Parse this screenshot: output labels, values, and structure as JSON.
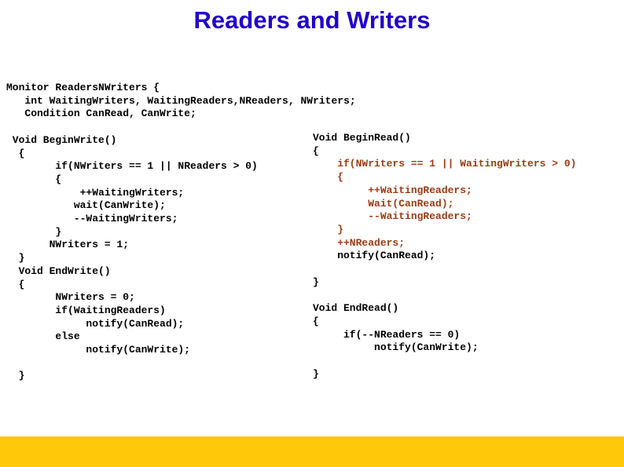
{
  "slide": {
    "title": "Readers and Writers",
    "title_color": "#2000CC",
    "background_color": "#ffffff",
    "bottom_bar_color": "#FFC808"
  },
  "code_left": {
    "name": "writer-monitor-code",
    "color_default": "#000000",
    "lines": [
      "Monitor ReadersNWriters {",
      "   int WaitingWriters, WaitingReaders,NReaders, NWriters;",
      "   Condition CanRead, CanWrite;",
      "",
      " Void BeginWrite()",
      "  {",
      "        if(NWriters == 1 || NReaders > 0)",
      "        {",
      "            ++WaitingWriters;",
      "           wait(CanWrite);",
      "           --WaitingWriters;",
      "        }",
      "       NWriters = 1;",
      "  }",
      "  Void EndWrite()",
      "  {",
      "        NWriters = 0;",
      "        if(WaitingReaders)",
      "             notify(CanRead);",
      "        else",
      "             notify(CanWrite);",
      "",
      "  }"
    ]
  },
  "code_right": {
    "name": "reader-monitor-code",
    "color_black": "#000000",
    "color_maroon": "#9E3B13",
    "lines": [
      {
        "text": "Void BeginRead()",
        "color": "black"
      },
      {
        "text": "{",
        "color": "black"
      },
      {
        "text": "    if(NWriters == 1 || WaitingWriters > 0)",
        "color": "maroon"
      },
      {
        "text": "    {",
        "color": "maroon"
      },
      {
        "text": "         ++WaitingReaders;",
        "color": "maroon"
      },
      {
        "text": "         Wait(CanRead);",
        "color": "maroon"
      },
      {
        "text": "         --WaitingReaders;",
        "color": "maroon"
      },
      {
        "text": "    }",
        "color": "maroon"
      },
      {
        "text": "    ++NReaders;",
        "color": "maroon"
      },
      {
        "text": "    notify(CanRead);",
        "color": "black"
      },
      {
        "text": "",
        "color": "black"
      },
      {
        "text": "}",
        "color": "black"
      },
      {
        "text": "",
        "color": "black"
      },
      {
        "text": "Void EndRead()",
        "color": "black"
      },
      {
        "text": "{",
        "color": "black"
      },
      {
        "text": "     if(--NReaders == 0)",
        "color": "black"
      },
      {
        "text": "          notify(CanWrite);",
        "color": "black"
      },
      {
        "text": "",
        "color": "black"
      },
      {
        "text": "}",
        "color": "black"
      }
    ]
  }
}
